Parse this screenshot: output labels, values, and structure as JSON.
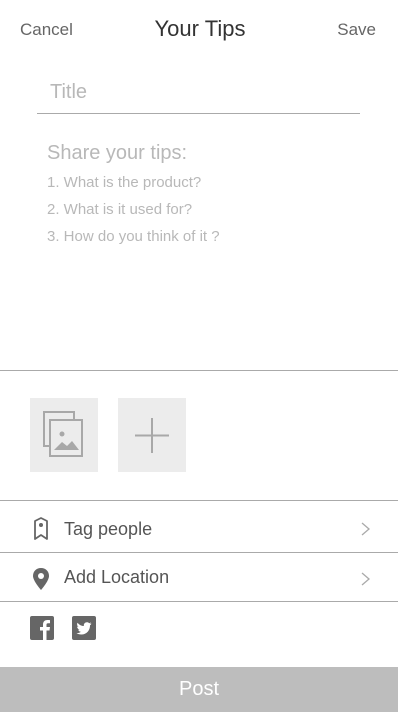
{
  "header": {
    "cancel_label": "Cancel",
    "title": "Your Tips",
    "save_label": "Save"
  },
  "title_field": {
    "placeholder": "Title",
    "value": ""
  },
  "body_field": {
    "placeholder_heading": "Share your tips:",
    "placeholder_lines": [
      "1. What is the product?",
      "2. What is it used for?",
      "3. How do you think of it ?"
    ]
  },
  "media": {
    "gallery_icon": "gallery-icon",
    "add_icon": "plus-icon"
  },
  "options": {
    "tag_people": {
      "label": "Tag people",
      "icon": "tag-icon"
    },
    "add_location": {
      "label": "Add Location",
      "icon": "location-pin-icon"
    }
  },
  "share": {
    "facebook_icon": "facebook-icon",
    "twitter_icon": "twitter-icon"
  },
  "footer": {
    "post_label": "Post"
  },
  "colors": {
    "post_button_bg": "#bdbdbd",
    "tile_bg": "#ececec",
    "placeholder_text": "#b8b8b8",
    "divider": "#aaaaaa"
  }
}
